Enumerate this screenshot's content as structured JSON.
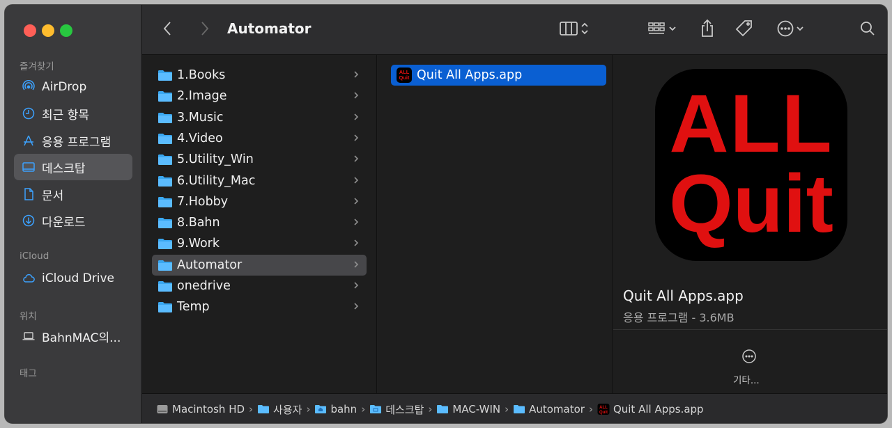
{
  "window": {
    "title": "Automator"
  },
  "sidebar": {
    "favorites_label": "즐겨찾기",
    "icloud_label": "iCloud",
    "locations_label": "위치",
    "tags_label": "태그",
    "items": [
      {
        "label": "AirDrop",
        "icon": "airdrop-icon"
      },
      {
        "label": "최근 항목",
        "icon": "clock-icon"
      },
      {
        "label": "응용 프로그램",
        "icon": "applications-icon"
      },
      {
        "label": "데스크탑",
        "icon": "desktop-icon",
        "selected": true
      },
      {
        "label": "문서",
        "icon": "document-icon"
      },
      {
        "label": "다운로드",
        "icon": "download-icon"
      },
      {
        "label": "iCloud Drive",
        "icon": "cloud-icon"
      },
      {
        "label": "BahnMAC의...",
        "icon": "laptop-icon"
      }
    ]
  },
  "toolbar": {
    "back": "back-icon",
    "forward": "forward-icon",
    "view": "column-view-icon",
    "group": "group-icon",
    "share": "share-icon",
    "tag": "tag-icon",
    "actions": "more-icon",
    "search": "search-icon"
  },
  "column1": {
    "items": [
      {
        "label": "1.Books"
      },
      {
        "label": "2.Image"
      },
      {
        "label": "3.Music"
      },
      {
        "label": "4.Video"
      },
      {
        "label": "5.Utility_Win"
      },
      {
        "label": "6.Utility_Mac"
      },
      {
        "label": "7.Hobby"
      },
      {
        "label": "8.Bahn"
      },
      {
        "label": "9.Work"
      },
      {
        "label": "Automator",
        "selected": true
      },
      {
        "label": "onedrive"
      },
      {
        "label": "Temp"
      }
    ]
  },
  "column2": {
    "items": [
      {
        "label": "Quit All Apps.app",
        "selected": true,
        "icon_text_1": "ALL",
        "icon_text_2": "Quit"
      }
    ]
  },
  "preview": {
    "icon_line1": "ALL",
    "icon_line2": "Quit",
    "name": "Quit All Apps.app",
    "info": "응용 프로그램 - 3.6MB",
    "more_label": "기타..."
  },
  "pathbar": {
    "crumbs": [
      {
        "label": "Macintosh HD",
        "icon": "disk-icon"
      },
      {
        "label": "사용자",
        "icon": "folder-icon"
      },
      {
        "label": "bahn",
        "icon": "home-folder-icon"
      },
      {
        "label": "데스크탑",
        "icon": "desktop-folder-icon"
      },
      {
        "label": "MAC-WIN",
        "icon": "folder-icon"
      },
      {
        "label": "Automator",
        "icon": "folder-icon"
      },
      {
        "label": "Quit All Apps.app",
        "icon": "app-icon"
      }
    ]
  },
  "colors": {
    "selection": "#0a5fd2",
    "accent": "#3ca2ff",
    "icon_red": "#e01010"
  }
}
